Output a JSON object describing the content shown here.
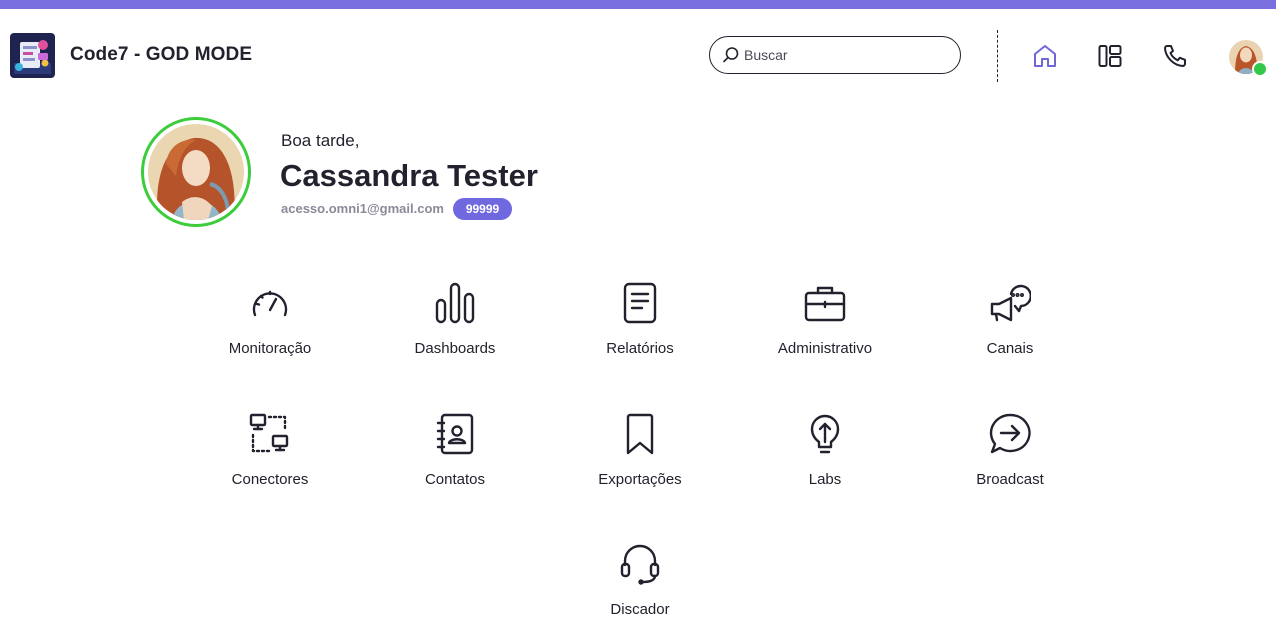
{
  "app": {
    "title": "Code7 - GOD MODE",
    "accent_color": "#7b70e0"
  },
  "search": {
    "placeholder": "Buscar",
    "value": ""
  },
  "nav": {
    "icons": [
      "home-icon",
      "layout-icon",
      "phone-icon"
    ],
    "active": "home-icon",
    "active_color": "#6f66d8"
  },
  "user": {
    "greeting": "Boa tarde,",
    "name": "Cassandra Tester",
    "email": "acesso.omni1@gmail.com",
    "badge": "99999",
    "status_color": "#34c84a",
    "badge_color": "#7068de"
  },
  "menu": {
    "items": [
      {
        "label": "Monitoração",
        "icon": "speedometer-icon"
      },
      {
        "label": "Dashboards",
        "icon": "bar-chart-icon"
      },
      {
        "label": "Relatórios",
        "icon": "document-icon"
      },
      {
        "label": "Administrativo",
        "icon": "briefcase-icon"
      },
      {
        "label": "Canais",
        "icon": "megaphone-chat-icon"
      },
      {
        "label": "Conectores",
        "icon": "connectors-icon"
      },
      {
        "label": "Contatos",
        "icon": "contacts-book-icon"
      },
      {
        "label": "Exportações",
        "icon": "bookmark-icon"
      },
      {
        "label": "Labs",
        "icon": "lightbulb-icon"
      },
      {
        "label": "Broadcast",
        "icon": "chat-arrow-icon"
      },
      {
        "label": "Discador",
        "icon": "headset-icon"
      }
    ]
  }
}
